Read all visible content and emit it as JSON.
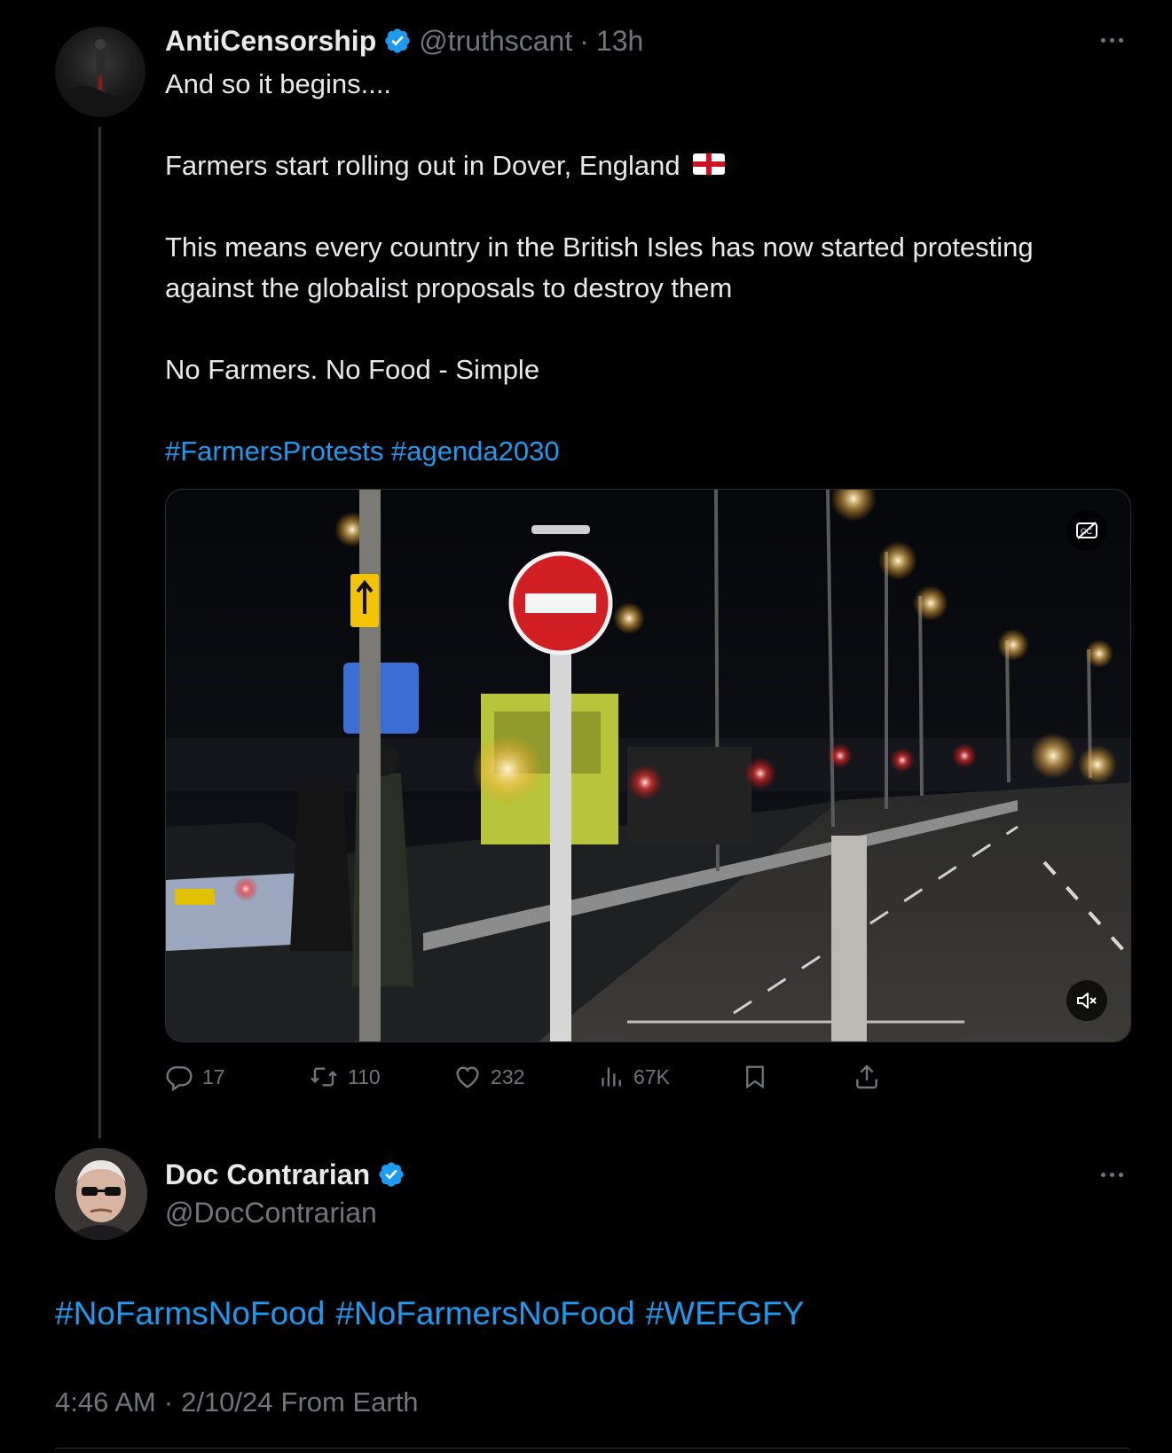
{
  "tweet1": {
    "display_name": "AntiCensorship",
    "handle": "@truthscant",
    "separator": "·",
    "time_ago": "13h",
    "lines": {
      "l1": "And so it begins....",
      "l2": "Farmers start rolling out in Dover, England",
      "l3a": "This means every country in the British Isles has now started protesting",
      "l3b": "against the globalist proposals to destroy them",
      "l4": "No Farmers. No Food - Simple"
    },
    "hashtags": [
      "#FarmersProtests",
      "#agenda2030"
    ],
    "actions": {
      "replies": "17",
      "reposts": "110",
      "likes": "232",
      "views": "67K"
    }
  },
  "tweet2": {
    "display_name": "Doc Contrarian",
    "handle": "@DocContrarian",
    "hashtags": [
      "#NoFarmsNoFood",
      "#NoFarmersNoFood",
      "#WEFGFY"
    ],
    "timestamp_time": "4:46 AM",
    "separator": "·",
    "timestamp_date": "2/10/24",
    "source": "From Earth"
  },
  "colors": {
    "background": "#000000",
    "text": "#e7e9ea",
    "muted": "#71767b",
    "link": "#1d9bf0",
    "verified": "#1d9bf0"
  },
  "icons": [
    "more-icon",
    "verified-badge-icon",
    "captions-off-icon",
    "mute-icon",
    "reply-icon",
    "repost-icon",
    "like-icon",
    "views-icon",
    "bookmark-icon",
    "share-icon",
    "england-flag-icon"
  ]
}
